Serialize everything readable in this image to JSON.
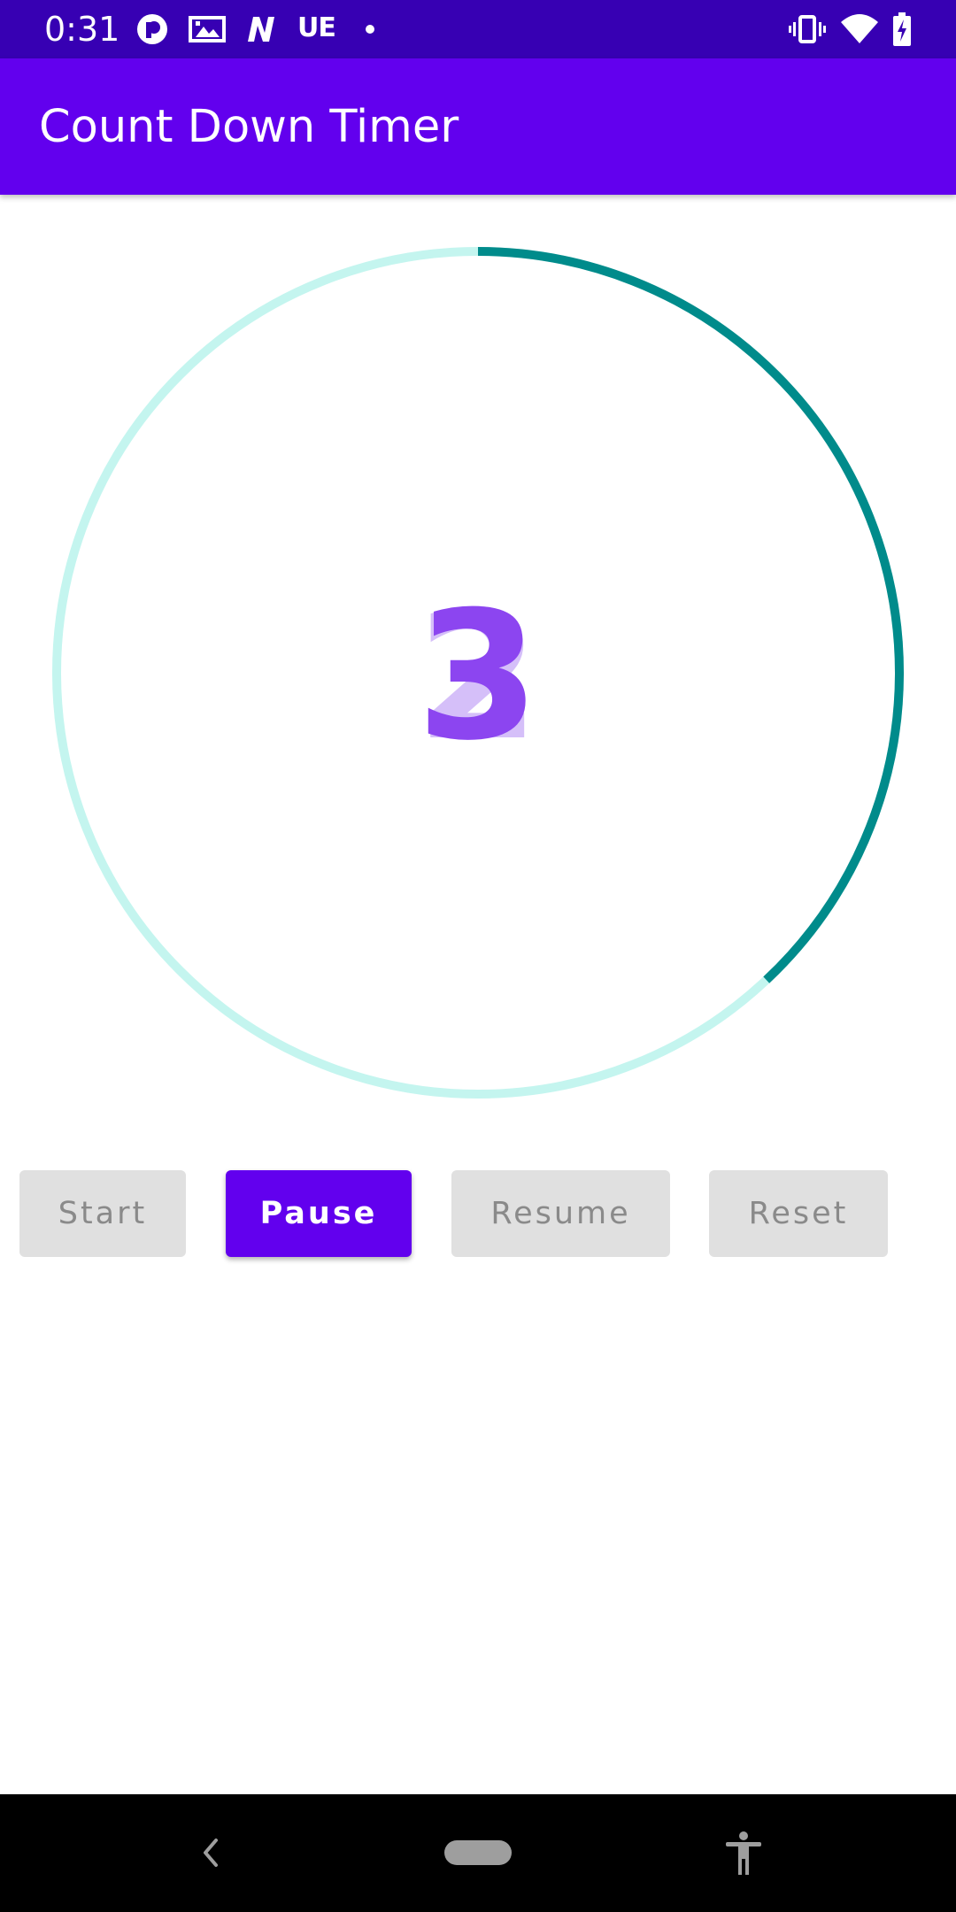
{
  "status_bar": {
    "time": "0:31",
    "carrier_text": "UE",
    "icons": [
      "at-sign-notification-icon",
      "gallery-icon",
      "n-app-icon",
      "dot-icon",
      "vibrate-icon",
      "wifi-icon",
      "battery-charging-icon"
    ]
  },
  "app_bar": {
    "title": "Count Down Timer"
  },
  "timer": {
    "current": "3",
    "previous": "2",
    "progress_fraction": 0.38,
    "track_color": "#c4f5ef",
    "progress_color": "#008b8b",
    "digit_color": "#8c45f0"
  },
  "buttons": {
    "start": "Start",
    "pause": "Pause",
    "resume": "Resume",
    "reset": "Reset"
  },
  "nav_bar": {
    "icons": [
      "back-icon",
      "home-pill-icon",
      "accessibility-icon"
    ]
  },
  "colors": {
    "primary": "#6200ee",
    "primary_dark": "#3700b3"
  }
}
